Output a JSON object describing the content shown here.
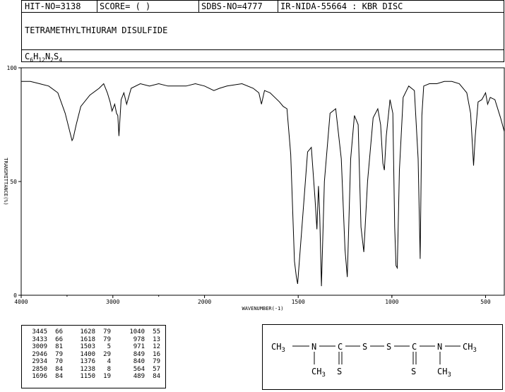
{
  "header": {
    "hit_no": "HIT-NO=3138",
    "score": "SCORE=  (   )",
    "sdbs_no": "SDBS-NO=4777",
    "ir_nida": "IR-NIDA-55664 : KBR DISC"
  },
  "compound": {
    "name": "TETRAMETHYLTHIURAM DISULFIDE",
    "formula_parts": [
      "C",
      "6",
      "H",
      "12",
      "N",
      "2",
      "S",
      "4"
    ]
  },
  "chart_data": {
    "type": "line",
    "xlabel": "WAVENUMBER(-1)",
    "ylabel": "TRANSMITTANCE(%)",
    "xlim": [
      4000,
      400
    ],
    "ylim": [
      0,
      100
    ],
    "x_ticks": [
      "4000",
      "3000",
      "2000",
      "1500",
      "1000",
      "500"
    ],
    "y_ticks": [
      "100",
      "50",
      "0"
    ],
    "grid": false,
    "series": [
      {
        "x": [
          4000,
          3900,
          3800,
          3700,
          3600,
          3520,
          3470,
          3445,
          3433,
          3400,
          3350,
          3250,
          3150,
          3100,
          3060,
          3030,
          3009,
          2980,
          2960,
          2946,
          2934,
          2910,
          2880,
          2850,
          2800,
          2700,
          2600,
          2500,
          2400,
          2300,
          2200,
          2100,
          2000,
          1950,
          1920,
          1880,
          1800,
          1740,
          1710,
          1696,
          1680,
          1650,
          1600,
          1580,
          1560,
          1540,
          1520,
          1510,
          1503,
          1480,
          1450,
          1430,
          1410,
          1400,
          1392,
          1385,
          1376,
          1360,
          1330,
          1300,
          1270,
          1250,
          1238,
          1220,
          1200,
          1180,
          1165,
          1150,
          1130,
          1100,
          1075,
          1060,
          1048,
          1040,
          1030,
          1010,
          995,
          985,
          978,
          971,
          960,
          940,
          910,
          880,
          860,
          849,
          840,
          830,
          800,
          760,
          720,
          680,
          640,
          600,
          580,
          570,
          564,
          555,
          540,
          520,
          500,
          489,
          475,
          450,
          420,
          400
        ],
        "y": [
          94,
          94,
          93,
          92,
          89,
          80,
          72,
          68,
          69,
          75,
          83,
          88,
          91,
          93,
          89,
          85,
          81,
          84,
          80,
          79,
          70,
          86,
          89,
          84,
          91,
          93,
          92,
          93,
          92,
          92,
          92,
          93,
          92,
          90,
          91,
          92,
          93,
          91,
          89,
          84,
          90,
          89,
          85,
          83,
          82,
          62,
          15,
          8,
          5,
          30,
          63,
          65,
          42,
          29,
          48,
          35,
          4,
          50,
          80,
          82,
          60,
          20,
          8,
          60,
          79,
          75,
          30,
          19,
          50,
          78,
          82,
          75,
          58,
          55,
          70,
          86,
          80,
          30,
          13,
          12,
          55,
          87,
          92,
          90,
          60,
          16,
          79,
          92,
          93,
          93,
          94,
          94,
          93,
          89,
          80,
          66,
          57,
          70,
          85,
          86,
          89,
          84,
          87,
          86,
          78,
          72
        ]
      }
    ]
  },
  "peak_table": [
    [
      [
        "3445",
        "66"
      ],
      [
        "3433",
        "66"
      ],
      [
        "3009",
        "81"
      ],
      [
        "2946",
        "79"
      ],
      [
        "2934",
        "70"
      ],
      [
        "2850",
        "84"
      ],
      [
        "1696",
        "84"
      ]
    ],
    [
      [
        "1628",
        "79"
      ],
      [
        "1618",
        "79"
      ],
      [
        "1503",
        "5"
      ],
      [
        "1400",
        "29"
      ],
      [
        "1376",
        "4"
      ],
      [
        "1238",
        "8"
      ],
      [
        "1150",
        "19"
      ]
    ],
    [
      [
        "1040",
        "55"
      ],
      [
        "978",
        "13"
      ],
      [
        "971",
        "12"
      ],
      [
        "849",
        "16"
      ],
      [
        "840",
        "79"
      ],
      [
        "564",
        "57"
      ],
      [
        "489",
        "84"
      ]
    ]
  ],
  "structure": {
    "left_group": "CH",
    "left_sub": "3",
    "n": "N",
    "c": "C",
    "s": "S",
    "bottom_group": "CH",
    "bottom_sub": "3"
  }
}
